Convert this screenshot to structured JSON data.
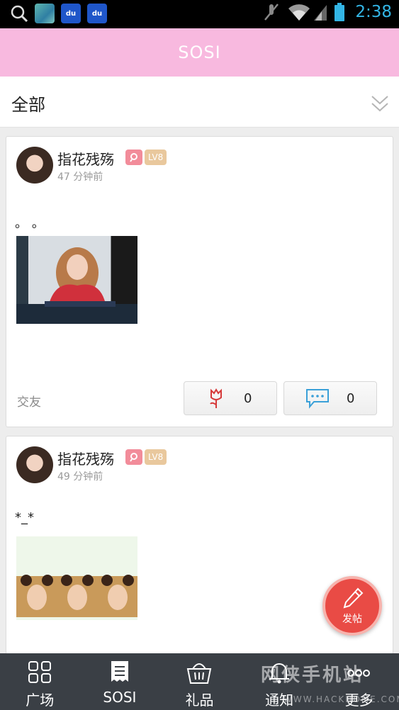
{
  "status_bar": {
    "time": "2:38",
    "left_icons": [
      "search-icon",
      "gallery-thumbnail",
      "baidu-icon",
      "baidu-icon"
    ],
    "right_icons": [
      "mute-icon",
      "wifi-icon",
      "signal-icon",
      "battery-icon"
    ],
    "baidu_text": "du"
  },
  "header": {
    "title": "SOSI"
  },
  "filter": {
    "label": "全部",
    "icon": "chevron-double-down-icon"
  },
  "posts": [
    {
      "author": "指花残殇",
      "level": "LV8",
      "time": "47 分钟前",
      "text": "。 。",
      "image": "photo-woman-signing",
      "tag": "交友",
      "likes": "0",
      "comments": "0"
    },
    {
      "author": "指花残殇",
      "level": "LV8",
      "time": "49 分钟前",
      "text": "*_*",
      "image": "photo-triptych-selfie"
    }
  ],
  "fab": {
    "label": "发帖",
    "icon": "pen-icon"
  },
  "nav": [
    {
      "label": "广场",
      "icon": "grid-icon"
    },
    {
      "label": "SOSI",
      "icon": "document-icon"
    },
    {
      "label": "礼品",
      "icon": "basket-icon"
    },
    {
      "label": "通知",
      "icon": "bell-icon"
    },
    {
      "label": "更多",
      "icon": "more-icon"
    }
  ],
  "watermark": {
    "text": "网侠手机站",
    "url_text": "WWW.HACKHOME.COM"
  },
  "colors": {
    "header_pink": "#f8b9df",
    "accent_red": "#e94b45",
    "nav_bg": "#3a3f45",
    "time_blue": "#33b5e5"
  }
}
